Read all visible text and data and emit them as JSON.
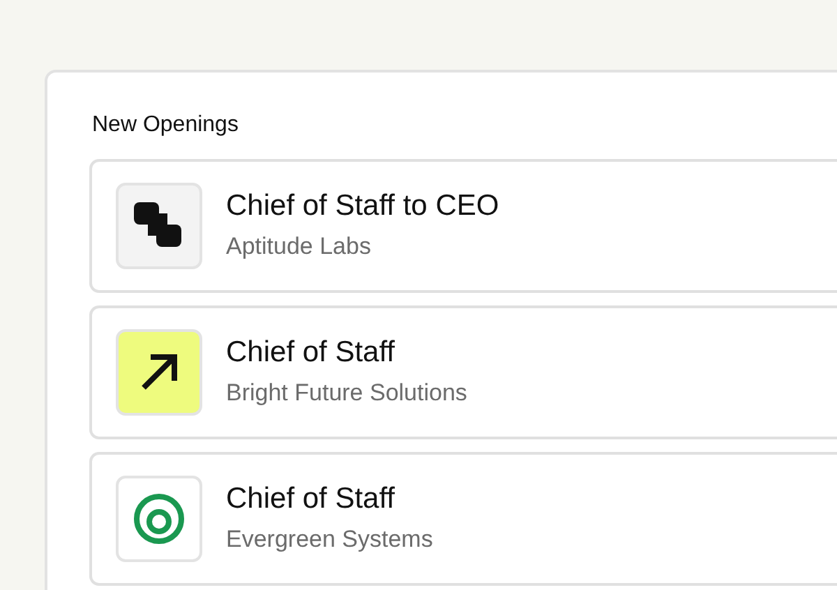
{
  "section": {
    "title": "New Openings"
  },
  "openings": [
    {
      "title": "Chief of Staff to CEO",
      "company": "Aptitude Labs",
      "kind": "blocks",
      "color": "#f3f3f3"
    },
    {
      "title": "Chief of Staff",
      "company": "Bright Future Solutions",
      "kind": "arrow",
      "color": "#eefb7e"
    },
    {
      "title": "Chief of Staff",
      "company": "Evergreen Systems",
      "kind": "rings",
      "color": "#ffffff"
    }
  ]
}
